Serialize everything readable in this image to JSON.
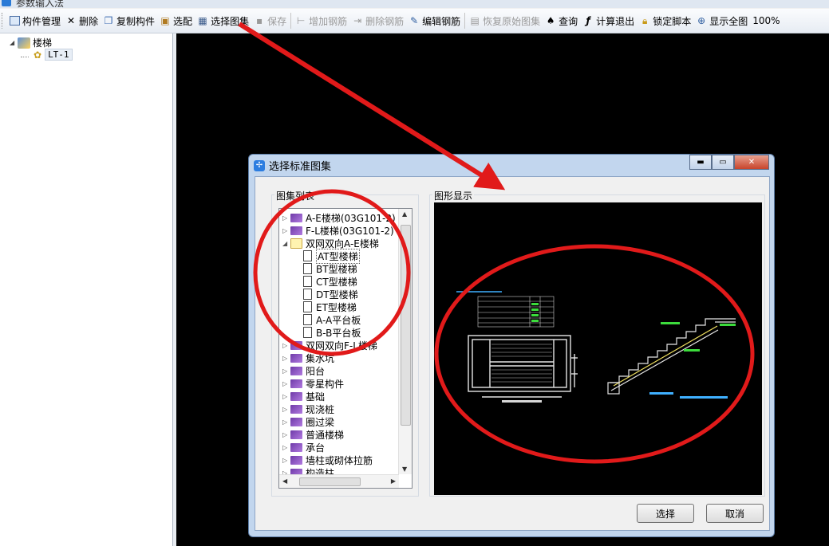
{
  "window": {
    "title": "参数输入法"
  },
  "toolbar": {
    "component_mgmt": "构件管理",
    "delete": "删除",
    "copy_component": "复制构件",
    "select_config": "选配",
    "select_atlas": "选择图集",
    "save": "保存",
    "add_rebar": "增加钢筋",
    "delete_rebar": "删除钢筋",
    "edit_rebar": "编辑钢筋",
    "restore_atlas": "恢复原始图集",
    "query": "查询",
    "calc_exit": "计算退出",
    "lock_script": "锁定脚本",
    "show_all": "显示全图",
    "zoom": "100%"
  },
  "tree": {
    "root": "楼梯",
    "child": "LT-1"
  },
  "dialog": {
    "title": "选择标准图集",
    "list_group_label": "图集列表",
    "preview_group_label": "图形显示",
    "ok_label": "选择",
    "cancel_label": "取消",
    "atlas_items": [
      "A-E楼梯(03G101-2)",
      "F-L楼梯(03G101-2)",
      "双网双向A-E楼梯",
      "AT型楼梯",
      "BT型楼梯",
      "CT型楼梯",
      "DT型楼梯",
      "ET型楼梯",
      "A-A平台板",
      "B-B平台板",
      "双网双向F-L楼梯",
      "集水坑",
      "阳台",
      "零星构件",
      "基础",
      "现浇桩",
      "圈过梁",
      "普通楼梯",
      "承台",
      "墙柱或砌体拉筋",
      "构造柱"
    ]
  },
  "colors": {
    "annotation": "#e11a1a",
    "cad_background": "#000000"
  }
}
